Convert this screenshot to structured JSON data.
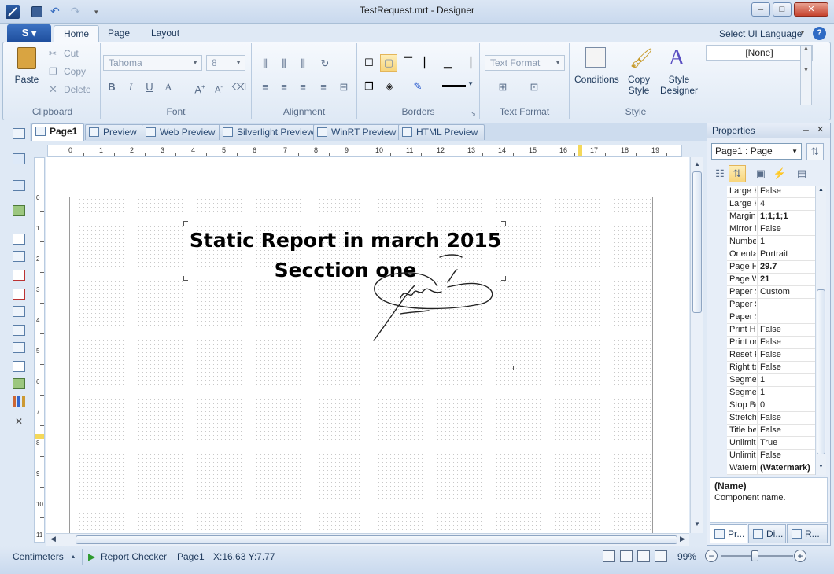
{
  "window": {
    "title": "TestRequest.mrt - Designer",
    "minimize": "–",
    "maximize": "□",
    "close": "✕"
  },
  "ribbon": {
    "app_button": "S ▾",
    "tabs": [
      "Home",
      "Page",
      "Layout"
    ],
    "select_ui_language": "Select UI Language",
    "help": "?",
    "clipboard": {
      "label": "Clipboard",
      "paste": "Paste",
      "cut": "Cut",
      "copy": "Copy",
      "delete": "Delete"
    },
    "font": {
      "label": "Font",
      "family": "Tahoma",
      "size": "8"
    },
    "alignment": {
      "label": "Alignment"
    },
    "borders": {
      "label": "Borders"
    },
    "text_format": {
      "label": "Text Format",
      "combo": "Text Format"
    },
    "style": {
      "label": "Style",
      "conditions": "Conditions",
      "copy_style_1": "Copy",
      "copy_style_2": "Style",
      "style_designer_1": "Style",
      "style_designer_2": "Designer",
      "style_value": "[None]"
    }
  },
  "doc_tabs": [
    "Page1",
    "Preview",
    "Web Preview",
    "Silverlight Preview",
    "WinRT Preview",
    "HTML Preview"
  ],
  "ruler": {
    "h_ticks": [
      "0",
      "1",
      "2",
      "3",
      "4",
      "5",
      "6",
      "7",
      "8",
      "9",
      "10",
      "11",
      "12",
      "13",
      "14",
      "15",
      "16",
      "17",
      "18",
      "19"
    ],
    "v_ticks": [
      "0",
      "1",
      "2",
      "3",
      "4",
      "5",
      "6",
      "7",
      "8",
      "9",
      "10",
      "11"
    ]
  },
  "report": {
    "line1": "Static Report in march 2015",
    "line2": "Secction one"
  },
  "properties": {
    "title": "Properties",
    "pin": "📌",
    "close": "✕",
    "selected": "Page1 : Page",
    "rows": [
      {
        "name": "Large H",
        "value": "False"
      },
      {
        "name": "Large H",
        "value": "4"
      },
      {
        "name": "Margins",
        "value": "1;1;1;1",
        "bold": true
      },
      {
        "name": "Mirror M",
        "value": "False"
      },
      {
        "name": "Number",
        "value": "1"
      },
      {
        "name": "Orientat",
        "value": "Portrait"
      },
      {
        "name": "Page H",
        "value": "29.7",
        "bold": true
      },
      {
        "name": "Page W",
        "value": "21",
        "bold": true
      },
      {
        "name": "Paper S",
        "value": "Custom"
      },
      {
        "name": "Paper S",
        "value": ""
      },
      {
        "name": "Paper S",
        "value": ""
      },
      {
        "name": "Print He",
        "value": "False"
      },
      {
        "name": "Print on",
        "value": "False"
      },
      {
        "name": "Reset P",
        "value": "False"
      },
      {
        "name": "Right to",
        "value": "False"
      },
      {
        "name": "Segmen",
        "value": "1"
      },
      {
        "name": "Segmen",
        "value": "1"
      },
      {
        "name": "Stop Be",
        "value": "0"
      },
      {
        "name": "Stretch",
        "value": "False"
      },
      {
        "name": "Title be",
        "value": "False"
      },
      {
        "name": "Unlimite",
        "value": "True"
      },
      {
        "name": "Unlimite",
        "value": "False"
      },
      {
        "name": "Waterm",
        "value": "(Watermark)",
        "bold": true
      }
    ],
    "desc_title": "(Name)",
    "desc_text": "Component name.",
    "bottom_tabs": [
      "Pr...",
      "Di...",
      "R..."
    ]
  },
  "status": {
    "units": "Centimeters",
    "report_checker": "Report Checker",
    "page": "Page1",
    "coords": "X:16.63  Y:7.77",
    "zoom": "99%",
    "zoom_minus": "−",
    "zoom_plus": "+"
  },
  "colors": {
    "accent": "#1f4f9e",
    "selection": "#f8d57b"
  }
}
